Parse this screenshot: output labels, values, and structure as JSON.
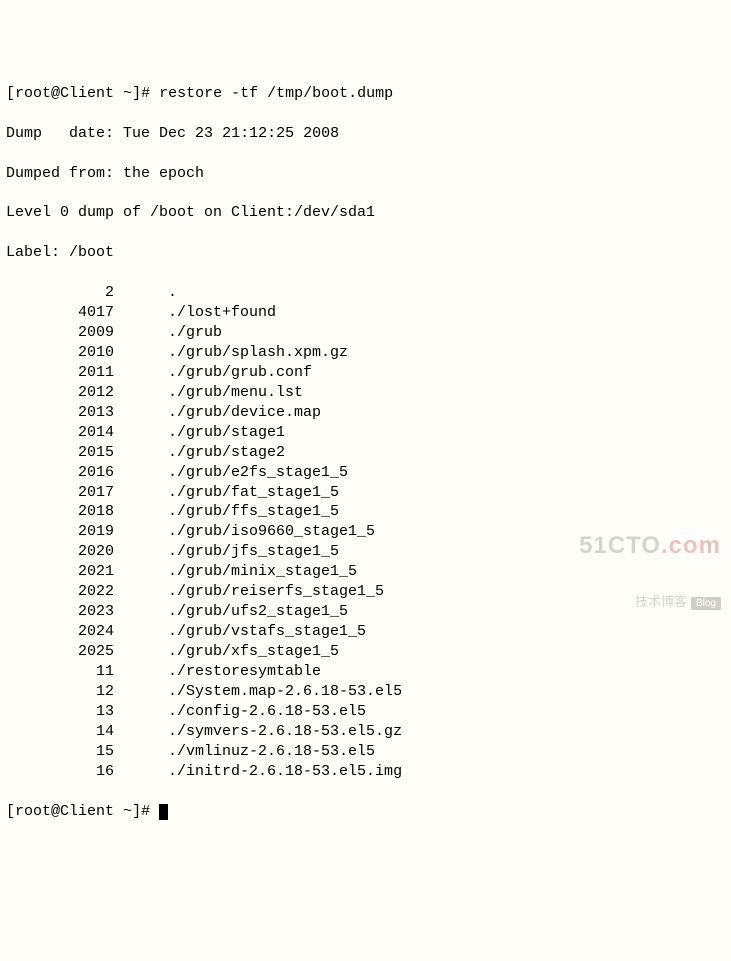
{
  "prompt_user": "root",
  "prompt_host": "Client",
  "prompt_dir": "~",
  "prompt_symbol": "#",
  "command": "restore -tf /tmp/boot.dump",
  "header": {
    "dump_date_label": "Dump   date:",
    "dump_date_value": "Tue Dec 23 21:12:25 2008",
    "dumped_from_label": "Dumped from:",
    "dumped_from_value": "the epoch",
    "level_line": "Level 0 dump of /boot on Client:/dev/sda1",
    "label_label": "Label:",
    "label_value": "/boot"
  },
  "entries": [
    {
      "inode": "2",
      "path": "."
    },
    {
      "inode": "4017",
      "path": "./lost+found"
    },
    {
      "inode": "2009",
      "path": "./grub"
    },
    {
      "inode": "2010",
      "path": "./grub/splash.xpm.gz"
    },
    {
      "inode": "2011",
      "path": "./grub/grub.conf"
    },
    {
      "inode": "2012",
      "path": "./grub/menu.lst"
    },
    {
      "inode": "2013",
      "path": "./grub/device.map"
    },
    {
      "inode": "2014",
      "path": "./grub/stage1"
    },
    {
      "inode": "2015",
      "path": "./grub/stage2"
    },
    {
      "inode": "2016",
      "path": "./grub/e2fs_stage1_5"
    },
    {
      "inode": "2017",
      "path": "./grub/fat_stage1_5"
    },
    {
      "inode": "2018",
      "path": "./grub/ffs_stage1_5"
    },
    {
      "inode": "2019",
      "path": "./grub/iso9660_stage1_5"
    },
    {
      "inode": "2020",
      "path": "./grub/jfs_stage1_5"
    },
    {
      "inode": "2021",
      "path": "./grub/minix_stage1_5"
    },
    {
      "inode": "2022",
      "path": "./grub/reiserfs_stage1_5"
    },
    {
      "inode": "2023",
      "path": "./grub/ufs2_stage1_5"
    },
    {
      "inode": "2024",
      "path": "./grub/vstafs_stage1_5"
    },
    {
      "inode": "2025",
      "path": "./grub/xfs_stage1_5"
    },
    {
      "inode": "11",
      "path": "./restoresymtable"
    },
    {
      "inode": "12",
      "path": "./System.map-2.6.18-53.el5"
    },
    {
      "inode": "13",
      "path": "./config-2.6.18-53.el5"
    },
    {
      "inode": "14",
      "path": "./symvers-2.6.18-53.el5.gz"
    },
    {
      "inode": "15",
      "path": "./vmlinuz-2.6.18-53.el5"
    },
    {
      "inode": "16",
      "path": "./initrd-2.6.18-53.el5.img"
    }
  ],
  "watermark": {
    "brand_pre": "51CTO",
    "brand_suf": ".com",
    "tagline": "技术博客",
    "badge": "Blog"
  }
}
